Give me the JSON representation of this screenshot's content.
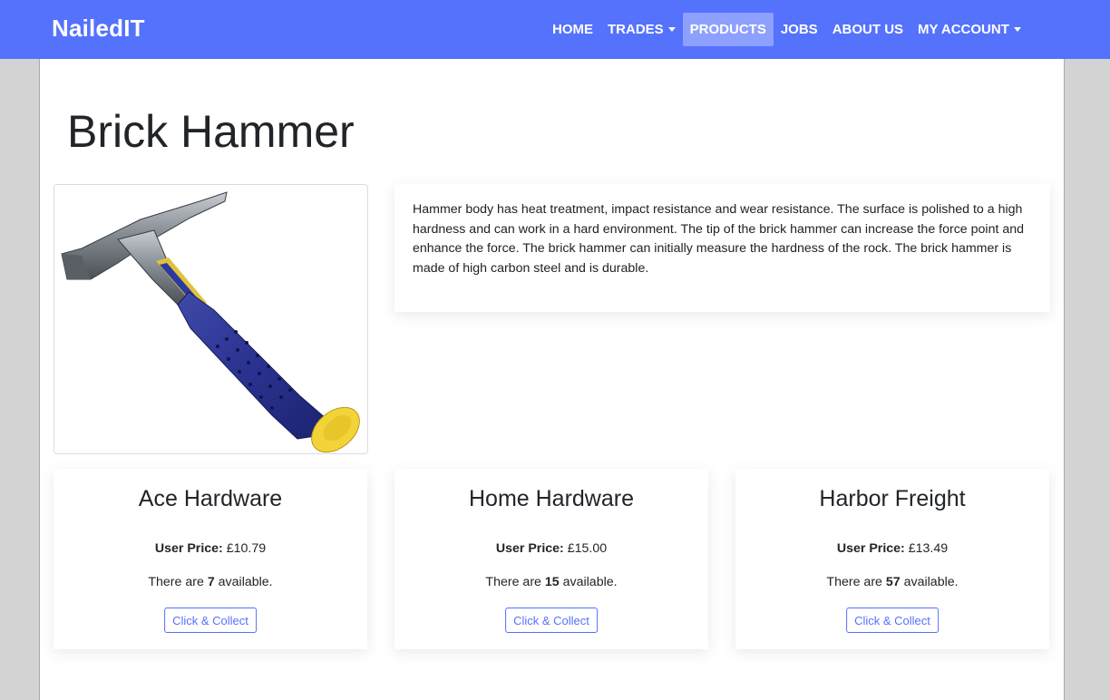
{
  "navbar": {
    "brand": "NailedIT",
    "items": [
      {
        "label": "HOME",
        "dropdown": false,
        "active": false
      },
      {
        "label": "TRADES",
        "dropdown": true,
        "active": false
      },
      {
        "label": "PRODUCTS",
        "dropdown": false,
        "active": true
      },
      {
        "label": "JOBS",
        "dropdown": false,
        "active": false
      },
      {
        "label": "ABOUT US",
        "dropdown": false,
        "active": false
      },
      {
        "label": "MY ACCOUNT",
        "dropdown": true,
        "active": false
      }
    ],
    "colors": {
      "background": "#5472fc",
      "active": "#8ea0fd"
    }
  },
  "product": {
    "title": "Brick Hammer",
    "image_icon": "hammer-image",
    "description": "Hammer body has heat treatment, impact resistance and wear resistance. The surface is polished to a high hardness and can work in a hard environment. The tip of the brick hammer can increase the force point and enhance the force. The brick hammer can initially measure the hardness of the rock. The brick hammer is made of high carbon steel and is durable."
  },
  "stores": [
    {
      "name": "Ace Hardware",
      "price_label": "User Price:",
      "price": "£10.79",
      "avail_prefix": "There are",
      "available": "7",
      "avail_suffix": "available.",
      "button": "Click & Collect"
    },
    {
      "name": "Home Hardware",
      "price_label": "User Price:",
      "price": "£15.00",
      "avail_prefix": "There are",
      "available": "15",
      "avail_suffix": "available.",
      "button": "Click & Collect"
    },
    {
      "name": "Harbor Freight",
      "price_label": "User Price:",
      "price": "£13.49",
      "avail_prefix": "There are",
      "available": "57",
      "avail_suffix": "available.",
      "button": "Click & Collect"
    }
  ]
}
